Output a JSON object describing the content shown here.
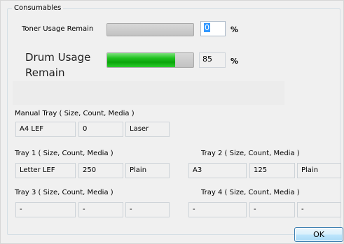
{
  "consumables": {
    "title": "Consumables",
    "toner": {
      "label": "Toner Usage Remain",
      "value": "0",
      "unit": "%",
      "level": 0
    },
    "drum": {
      "label_line1": "Drum Usage",
      "label_line2": "Remain",
      "value": "85",
      "unit": "%",
      "level": 85
    }
  },
  "trays": {
    "manual": {
      "label": "Manual Tray ( Size, Count, Media )",
      "size": "A4 LEF",
      "count": "0",
      "media": "Laser"
    },
    "tray1": {
      "label": "Tray 1 ( Size, Count, Media )",
      "size": "Letter LEF",
      "count": "250",
      "media": "Plain"
    },
    "tray2": {
      "label": "Tray 2 ( Size, Count, Media )",
      "size": "A3",
      "count": "125",
      "media": "Plain"
    },
    "tray3": {
      "label": "Tray 3 ( Size, Count, Media )",
      "size": "-",
      "count": "-",
      "media": "-"
    },
    "tray4": {
      "label": "Tray 4 ( Size, Count, Media )",
      "size": "-",
      "count": "-",
      "media": "-"
    }
  },
  "buttons": {
    "ok_label": "OK"
  },
  "colors": {
    "progress_fill": "#16b416",
    "ok_border": "#3c7fb1"
  }
}
